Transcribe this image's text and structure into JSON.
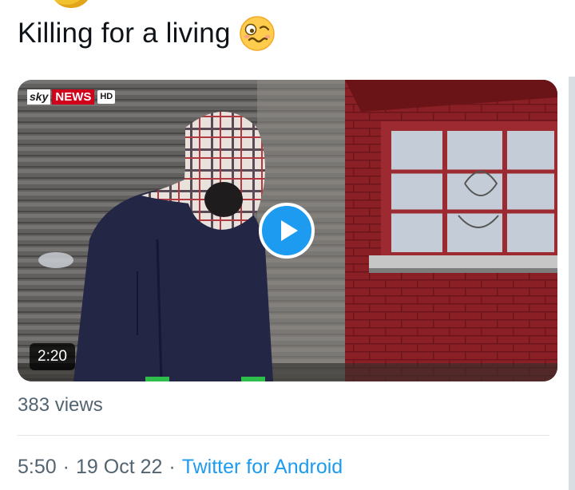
{
  "tweet": {
    "text": "Killing for a living",
    "emoji": "woozy-face"
  },
  "media": {
    "logo": {
      "sky": "sky",
      "news": "NEWS",
      "hd": "HD"
    },
    "duration": "2:20",
    "play_icon": "play-icon"
  },
  "stats": {
    "views": "383 views"
  },
  "meta": {
    "time": "5:50",
    "separator": "·",
    "date": "19 Oct 22",
    "source": "Twitter for Android"
  },
  "colors": {
    "accent": "#1d9bf0",
    "text_primary": "#0f1419",
    "text_secondary": "#536471"
  }
}
